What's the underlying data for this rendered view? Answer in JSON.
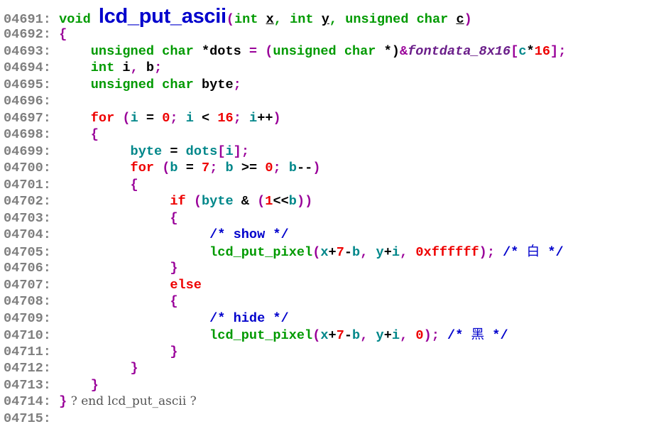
{
  "colors": {
    "line_number": "#7f7f7f",
    "type_keyword": "#009a00",
    "control_keyword": "#ee0000",
    "bracket": "#990099",
    "variable": "#00878a",
    "number": "#ee0000",
    "comment": "#0000cc",
    "global": "#6b1f8a",
    "background": "#ffffff"
  },
  "lines": [
    {
      "num": "04691:",
      "indent": " ",
      "tokens": [
        {
          "t": "void ",
          "c": "kw"
        },
        {
          "t": "lcd_put_ascii",
          "c": "fn"
        },
        {
          "t": "(",
          "c": "br"
        },
        {
          "t": "int ",
          "c": "kw"
        },
        {
          "t": "x",
          "c": "txt u"
        },
        {
          "t": ", ",
          "c": "kw"
        },
        {
          "t": "int ",
          "c": "kw"
        },
        {
          "t": "y",
          "c": "txt u"
        },
        {
          "t": ", ",
          "c": "kw"
        },
        {
          "t": "unsigned char ",
          "c": "kw"
        },
        {
          "t": "c",
          "c": "txt u"
        },
        {
          "t": ")",
          "c": "br"
        }
      ]
    },
    {
      "num": "04692:",
      "indent": " ",
      "tokens": [
        {
          "t": "{",
          "c": "br"
        }
      ]
    },
    {
      "num": "04693:",
      "indent": "     ",
      "tokens": [
        {
          "t": "unsigned char ",
          "c": "kw"
        },
        {
          "t": "*dots",
          "c": "txt"
        },
        {
          "t": " = (",
          "c": "br"
        },
        {
          "t": "unsigned char ",
          "c": "kw"
        },
        {
          "t": "*)",
          "c": "txt"
        },
        {
          "t": "&",
          "c": "br"
        },
        {
          "t": "fontdata_8x16",
          "c": "gl"
        },
        {
          "t": "[",
          "c": "br"
        },
        {
          "t": "c",
          "c": "var"
        },
        {
          "t": "*",
          "c": "txt"
        },
        {
          "t": "16",
          "c": "num"
        },
        {
          "t": "];",
          "c": "br"
        }
      ]
    },
    {
      "num": "04694:",
      "indent": "     ",
      "tokens": [
        {
          "t": "int ",
          "c": "kw"
        },
        {
          "t": "i",
          "c": "txt"
        },
        {
          "t": ", ",
          "c": "br"
        },
        {
          "t": "b",
          "c": "txt"
        },
        {
          "t": ";",
          "c": "br"
        }
      ]
    },
    {
      "num": "04695:",
      "indent": "     ",
      "tokens": [
        {
          "t": "unsigned char ",
          "c": "kw"
        },
        {
          "t": "byte",
          "c": "txt"
        },
        {
          "t": ";",
          "c": "br"
        }
      ]
    },
    {
      "num": "04696:",
      "indent": "",
      "tokens": []
    },
    {
      "num": "04697:",
      "indent": "     ",
      "tokens": [
        {
          "t": "for ",
          "c": "ctl"
        },
        {
          "t": "(",
          "c": "br"
        },
        {
          "t": "i",
          "c": "var"
        },
        {
          "t": " = ",
          "c": "txt"
        },
        {
          "t": "0",
          "c": "num"
        },
        {
          "t": "; ",
          "c": "br"
        },
        {
          "t": "i",
          "c": "var"
        },
        {
          "t": " < ",
          "c": "txt"
        },
        {
          "t": "16",
          "c": "num"
        },
        {
          "t": "; ",
          "c": "br"
        },
        {
          "t": "i",
          "c": "var"
        },
        {
          "t": "++",
          "c": "txt"
        },
        {
          "t": ")",
          "c": "br"
        }
      ]
    },
    {
      "num": "04698:",
      "indent": "     ",
      "tokens": [
        {
          "t": "{",
          "c": "br"
        }
      ]
    },
    {
      "num": "04699:",
      "indent": "          ",
      "tokens": [
        {
          "t": "byte",
          "c": "var"
        },
        {
          "t": " = ",
          "c": "txt"
        },
        {
          "t": "dots",
          "c": "var"
        },
        {
          "t": "[",
          "c": "br"
        },
        {
          "t": "i",
          "c": "var"
        },
        {
          "t": "];",
          "c": "br"
        }
      ]
    },
    {
      "num": "04700:",
      "indent": "          ",
      "tokens": [
        {
          "t": "for ",
          "c": "ctl"
        },
        {
          "t": "(",
          "c": "br"
        },
        {
          "t": "b",
          "c": "var"
        },
        {
          "t": " = ",
          "c": "txt"
        },
        {
          "t": "7",
          "c": "num"
        },
        {
          "t": "; ",
          "c": "br"
        },
        {
          "t": "b",
          "c": "var"
        },
        {
          "t": " >= ",
          "c": "txt"
        },
        {
          "t": "0",
          "c": "num"
        },
        {
          "t": "; ",
          "c": "br"
        },
        {
          "t": "b",
          "c": "var"
        },
        {
          "t": "--",
          "c": "txt"
        },
        {
          "t": ")",
          "c": "br"
        }
      ]
    },
    {
      "num": "04701:",
      "indent": "          ",
      "tokens": [
        {
          "t": "{",
          "c": "br"
        }
      ]
    },
    {
      "num": "04702:",
      "indent": "               ",
      "tokens": [
        {
          "t": "if ",
          "c": "ctl"
        },
        {
          "t": "(",
          "c": "br"
        },
        {
          "t": "byte",
          "c": "var"
        },
        {
          "t": " & ",
          "c": "txt"
        },
        {
          "t": "(",
          "c": "br"
        },
        {
          "t": "1",
          "c": "num"
        },
        {
          "t": "<<",
          "c": "txt"
        },
        {
          "t": "b",
          "c": "var"
        },
        {
          "t": "))",
          "c": "br"
        }
      ]
    },
    {
      "num": "04703:",
      "indent": "               ",
      "tokens": [
        {
          "t": "{",
          "c": "br"
        }
      ]
    },
    {
      "num": "04704:",
      "indent": "                    ",
      "tokens": [
        {
          "t": "/* show */",
          "c": "cm"
        }
      ]
    },
    {
      "num": "04705:",
      "indent": "                    ",
      "tokens": [
        {
          "t": "lcd_put_pixel",
          "c": "kw"
        },
        {
          "t": "(",
          "c": "br"
        },
        {
          "t": "x",
          "c": "var"
        },
        {
          "t": "+",
          "c": "txt"
        },
        {
          "t": "7",
          "c": "num"
        },
        {
          "t": "-",
          "c": "txt"
        },
        {
          "t": "b",
          "c": "var"
        },
        {
          "t": ", ",
          "c": "br"
        },
        {
          "t": "y",
          "c": "var"
        },
        {
          "t": "+",
          "c": "txt"
        },
        {
          "t": "i",
          "c": "var"
        },
        {
          "t": ", ",
          "c": "br"
        },
        {
          "t": "0xffffff",
          "c": "num"
        },
        {
          "t": "); ",
          "c": "br"
        },
        {
          "t": "/* ",
          "c": "cm"
        },
        {
          "t": "白",
          "c": "cm cjk"
        },
        {
          "t": " */",
          "c": "cm"
        }
      ]
    },
    {
      "num": "04706:",
      "indent": "               ",
      "tokens": [
        {
          "t": "}",
          "c": "br"
        }
      ]
    },
    {
      "num": "04707:",
      "indent": "               ",
      "tokens": [
        {
          "t": "else",
          "c": "ctl"
        }
      ]
    },
    {
      "num": "04708:",
      "indent": "               ",
      "tokens": [
        {
          "t": "{",
          "c": "br"
        }
      ]
    },
    {
      "num": "04709:",
      "indent": "                    ",
      "tokens": [
        {
          "t": "/* hide */",
          "c": "cm"
        }
      ]
    },
    {
      "num": "04710:",
      "indent": "                    ",
      "tokens": [
        {
          "t": "lcd_put_pixel",
          "c": "kw"
        },
        {
          "t": "(",
          "c": "br"
        },
        {
          "t": "x",
          "c": "var"
        },
        {
          "t": "+",
          "c": "txt"
        },
        {
          "t": "7",
          "c": "num"
        },
        {
          "t": "-",
          "c": "txt"
        },
        {
          "t": "b",
          "c": "var"
        },
        {
          "t": ", ",
          "c": "br"
        },
        {
          "t": "y",
          "c": "var"
        },
        {
          "t": "+",
          "c": "txt"
        },
        {
          "t": "i",
          "c": "var"
        },
        {
          "t": ", ",
          "c": "br"
        },
        {
          "t": "0",
          "c": "num"
        },
        {
          "t": "); ",
          "c": "br"
        },
        {
          "t": "/* ",
          "c": "cm"
        },
        {
          "t": "黑",
          "c": "cm cjk"
        },
        {
          "t": " */",
          "c": "cm"
        }
      ]
    },
    {
      "num": "04711:",
      "indent": "               ",
      "tokens": [
        {
          "t": "}",
          "c": "br"
        }
      ]
    },
    {
      "num": "04712:",
      "indent": "          ",
      "tokens": [
        {
          "t": "}",
          "c": "br"
        }
      ]
    },
    {
      "num": "04713:",
      "indent": "     ",
      "tokens": [
        {
          "t": "}",
          "c": "br"
        }
      ]
    },
    {
      "num": "04714:",
      "indent": " ",
      "tokens": [
        {
          "t": "}",
          "c": "br"
        },
        {
          "t": " ? end lcd_put_ascii ?",
          "c": "end"
        }
      ]
    },
    {
      "num": "04715:",
      "indent": "",
      "tokens": []
    }
  ]
}
